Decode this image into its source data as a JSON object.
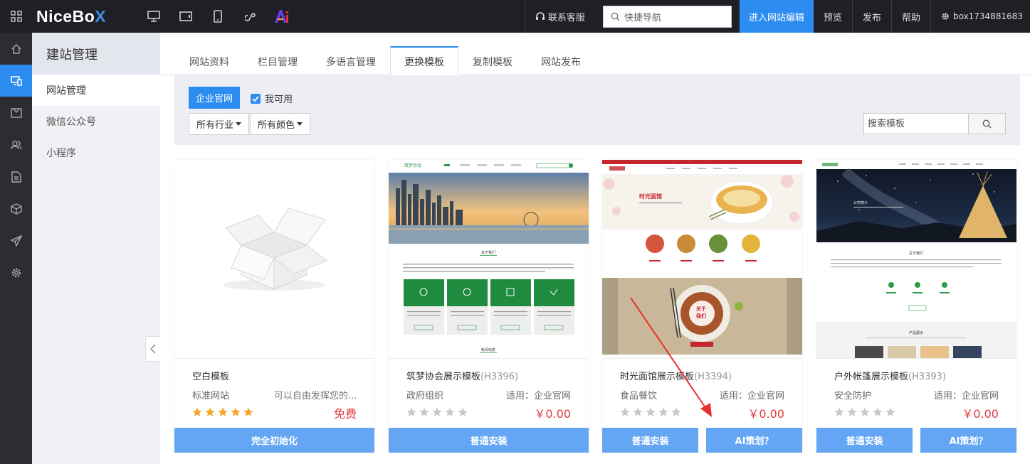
{
  "topbar": {
    "logo_main": "NiceBo",
    "logo_x": "X",
    "service_label": "联系客服",
    "quick_nav_placeholder": "快捷导航",
    "enter_edit_label": "进入网站编辑",
    "preview_label": "预览",
    "publish_label": "发布",
    "help_label": "帮助",
    "account_label": "box1734881683",
    "ai_badge": "Ai"
  },
  "submenu": {
    "title": "建站管理",
    "items": [
      {
        "label": "网站管理"
      },
      {
        "label": "微信公众号"
      },
      {
        "label": "小程序"
      }
    ]
  },
  "tabs": [
    {
      "label": "网站资料"
    },
    {
      "label": "栏目管理"
    },
    {
      "label": "多语言管理"
    },
    {
      "label": "更换模板"
    },
    {
      "label": "复制模板"
    },
    {
      "label": "网站发布"
    }
  ],
  "filter": {
    "enterprise_label": "企业官网",
    "available_label": "我可用",
    "industry_label": "所有行业",
    "color_label": "所有颜色",
    "search_placeholder": "搜索模板"
  },
  "cards": [
    {
      "title": "空白模板",
      "code": "",
      "category": "标准网站",
      "desc": "可以自由发挥您的...",
      "use": "",
      "price": "免费",
      "buttons": [
        "完全初始化"
      ]
    },
    {
      "title": "筑梦协会展示模板",
      "code": "(H3396)",
      "category": "政府组织",
      "desc": "",
      "use": "适用：企业官网",
      "price": "￥0.00",
      "buttons": [
        "普通安装"
      ],
      "preview": {
        "site_name": "筑梦协会",
        "section_title": "关于我们",
        "news_title": "新闻动态"
      }
    },
    {
      "title": "时光面馆展示模板",
      "code": "(H3394)",
      "category": "食品餐饮",
      "desc": "",
      "use": "适用：企业官网",
      "price": "￥0.00",
      "buttons": [
        "普通安装",
        "AI策划？"
      ],
      "preview": {
        "hero_title": "时光面馆",
        "about": "关于",
        "about2": "我们"
      }
    },
    {
      "title": "户外帐篷展示模板",
      "code": "(H3393)",
      "category": "安全防护",
      "desc": "",
      "use": "适用：企业官网",
      "price": "￥0.00",
      "buttons": [
        "普通安装",
        "AI策划？"
      ],
      "preview": {
        "hero_title": "公司简介",
        "section_title": "关于我们",
        "products_title": "产品展示"
      }
    }
  ],
  "colors": {
    "accent": "#2d8cf0",
    "button": "#64a6f4",
    "price": "#e4393c",
    "star_gold": "#f5a623",
    "star_grey": "#c8c8c8",
    "arrow_red": "#e8322b"
  }
}
